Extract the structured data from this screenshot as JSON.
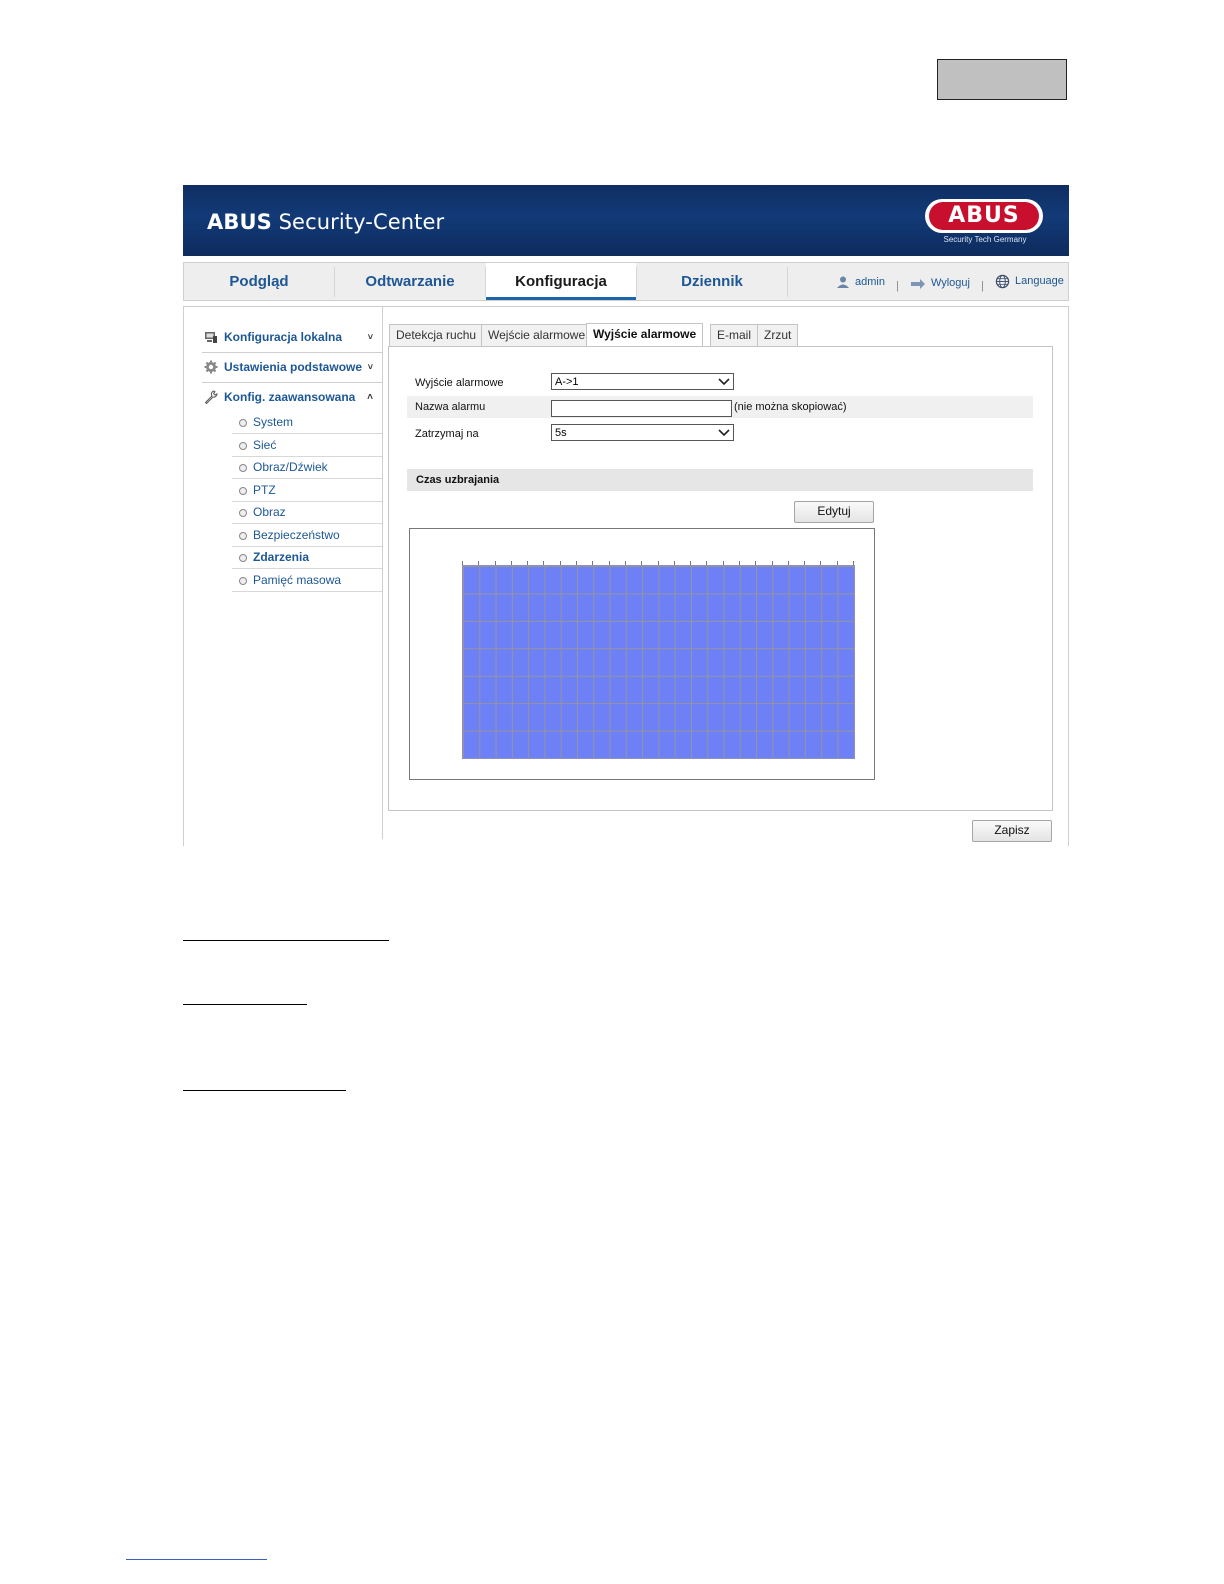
{
  "app": {
    "brand_bold": "ABUS",
    "brand_rest": " Security-Center",
    "logo_text": "ABUS",
    "logo_tagline": "Security Tech Germany"
  },
  "nav": {
    "tabs": [
      {
        "label": "Podgląd"
      },
      {
        "label": "Odtwarzanie"
      },
      {
        "label": "Konfiguracja",
        "active": true
      },
      {
        "label": "Dziennik"
      }
    ],
    "user": "admin",
    "logout": "Wyloguj",
    "language": "Language"
  },
  "sidebar": {
    "sections": [
      {
        "label": "Konfiguracja lokalna",
        "icon": "computer-icon",
        "state": "collapsed"
      },
      {
        "label": "Ustawienia podstawowe",
        "icon": "gear-icon",
        "state": "collapsed"
      },
      {
        "label": "Konfig. zaawansowana",
        "icon": "wrench-icon",
        "state": "expanded"
      }
    ],
    "items": [
      {
        "label": "System"
      },
      {
        "label": "Sieć"
      },
      {
        "label": "Obraz/Dźwiek"
      },
      {
        "label": "PTZ"
      },
      {
        "label": "Obraz"
      },
      {
        "label": "Bezpieczeństwo"
      },
      {
        "label": "Zdarzenia",
        "active": true
      },
      {
        "label": "Pamięć masowa"
      }
    ]
  },
  "tabs": [
    {
      "label": "Detekcja ruchu"
    },
    {
      "label": "Wejście alarmowe"
    },
    {
      "label": "Wyjście alarmowe",
      "active": true
    },
    {
      "label": "E-mail"
    },
    {
      "label": "Zrzut"
    }
  ],
  "form": {
    "output_label": "Wyjście alarmowe",
    "output_value": "A->1",
    "name_label": "Nazwa alarmu",
    "name_value": "",
    "name_note": "(nie można skopiować)",
    "hold_label": "Zatrzymaj na",
    "hold_value": "5s"
  },
  "schedule": {
    "section_title": "Czas uzbrajania",
    "edit_button": "Edytuj",
    "rows": 7,
    "columns": 24,
    "fill_color": "#6e80f6"
  },
  "save_button": "Zapisz",
  "colors": {
    "brand_blue": "#123a78",
    "link_blue": "#1d5795",
    "logo_red": "#c8102e"
  }
}
